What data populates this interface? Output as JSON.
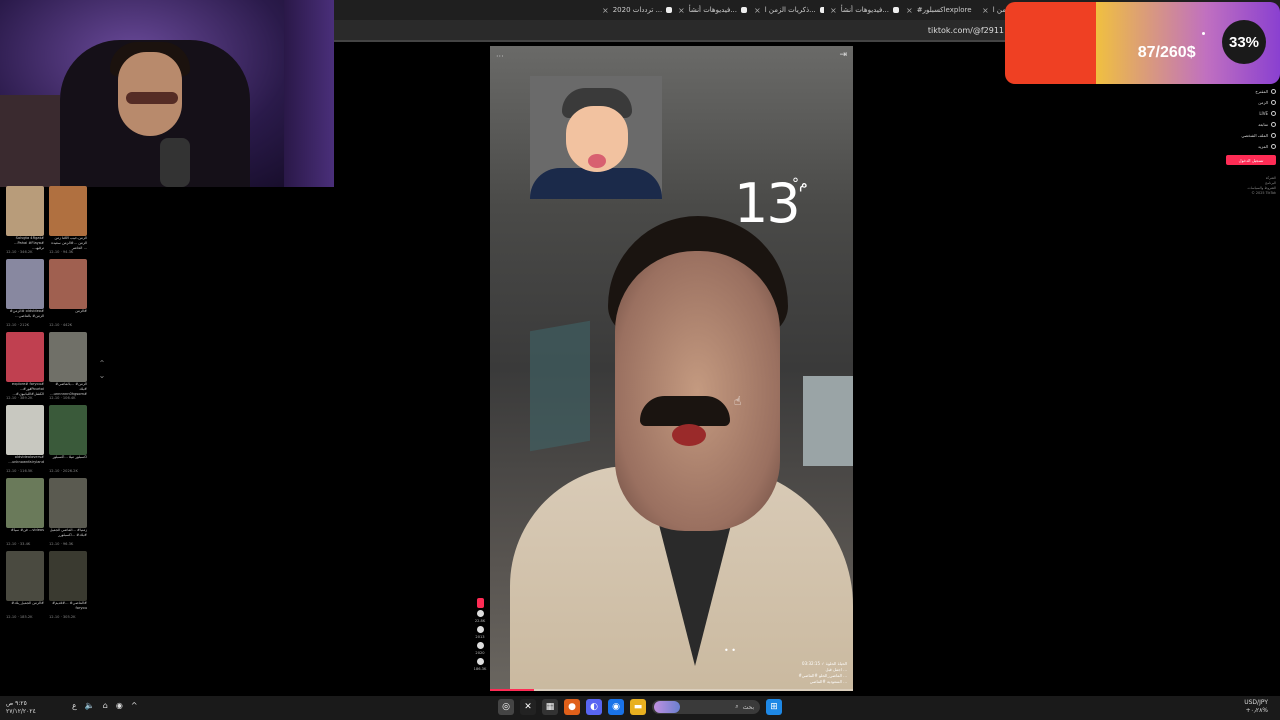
{
  "browser": {
    "tabs": [
      {
        "label": "كرات الزمن ا..."
      },
      {
        "label": "فيديوهات أنشأ..."
      },
      {
        "label": "ال بالفيديو الأبلد"
      },
      {
        "label": "ذكريات الزمن ا..."
      },
      {
        "label": "#اكسبلورexplore"
      },
      {
        "label": "فيديوهات أنشأ..."
      },
      {
        "label": "ذكريات الزمن ا..."
      },
      {
        "label": "فيديوهات أنشأ..."
      },
      {
        "label": "ترددات 2020 ..."
      }
    ],
    "url": "tiktok.com/@f2911",
    "close_icon": "×"
  },
  "donation": {
    "amount": "87/260$",
    "percent_label": "33%",
    "progress_fraction": 0.33,
    "colors": {
      "fill": "#ef4023",
      "gradient_start": "#f0c040",
      "gradient_end": "#8a40d0"
    }
  },
  "grid": {
    "items": [
      {
        "caption": "Solvgta 4Rgat# ...Pahai #Flaya# ...ترقيهـ",
        "meta": "12-10 · 346.2K",
        "color": "#b89c7a"
      },
      {
        "caption": "الزمن-حيب الأقنا زمن الزمن ...#الزمن سعيدة الحاضر ...",
        "meta": "12-10 · 94.3K",
        "color": "#b07040"
      },
      {
        "caption": "#الزمن# oldvideo# ...الزمن# بالماضي",
        "meta": "12-10 · 212K",
        "color": "#8888a0"
      },
      {
        "caption": "الزمن#",
        "meta": "12-10 · 442K",
        "color": "#a06050"
      },
      {
        "caption": "explore# foryou# ...#فورPourtoi ...#الكشل#اللبانيون",
        "meta": "12-10 · 389.2K",
        "color": "#c04050"
      },
      {
        "caption": "#الزمن# ...بالماضي بلاد# ...unnnnnn0hgsom#",
        "meta": "12-10 · 106.4K",
        "color": "#707068"
      },
      {
        "caption": "oldvideolovers# ...unknownfairyland",
        "meta": "12-10 · 116.5K",
        "color": "#c8c8c0"
      },
      {
        "caption": "اكسبلور ميلا ...اكسبلور",
        "meta": "12-10 · 2026.2K",
        "color": "#3a5a3a"
      },
      {
        "caption": "#فن# سيأ ...videos",
        "meta": "12-10 · 33.4K",
        "color": "#6a7a5a"
      },
      {
        "caption": "زمنيا# ...الماضي الجميل بلاد# ...اكسبلورر#",
        "meta": "12-10 · 96.3K",
        "color": "#5a5a50"
      },
      {
        "caption": "#الزمن الجميل_بلاد#",
        "meta": "12-10 · 185.2K",
        "color": "#4a4a40"
      },
      {
        "caption": "#الماضي# ...#قديم# foryou",
        "meta": "12-10 · 305.2K",
        "color": "#3a3a30"
      }
    ]
  },
  "video": {
    "temperature": "13",
    "temperature_unit": "°م",
    "more_icon": "···",
    "fullscreen_icon": "⇥",
    "dots": "• •",
    "progress_fraction": 0.12,
    "caption_lines": [
      "الحياة الحلوة ✓ 03:32:15",
      "اجمل قبل ...",
      "#الماضي_الحلو #الماضي ...",
      "السعودية #الماضي ..."
    ]
  },
  "rail": {
    "counts": [
      "22.8K",
      "2013",
      "2020",
      "186.3K"
    ]
  },
  "right_menu": {
    "items": [
      {
        "label": "المقترح"
      },
      {
        "label": "الزمن"
      },
      {
        "label": "LIVE"
      },
      {
        "label": "متابعة"
      },
      {
        "label": "الملف الشخصي"
      },
      {
        "label": "المزيد"
      }
    ],
    "login_label": "تسجيل الدخول",
    "footer_lines": [
      "الشركة",
      "البرنامج",
      "الشروط والسياسات",
      "© 2025 TikTok"
    ]
  },
  "taskbar": {
    "time": "٩:٢٥ ص",
    "date": "٢٧/١٢/٢٠٢٤",
    "sys_icons": [
      "ع",
      "🔈",
      "⌂",
      "◉",
      "^"
    ],
    "search_placeholder": "بحث",
    "right_top": "USD/JPY",
    "right_bottom": "+٠٫٢٨%"
  }
}
